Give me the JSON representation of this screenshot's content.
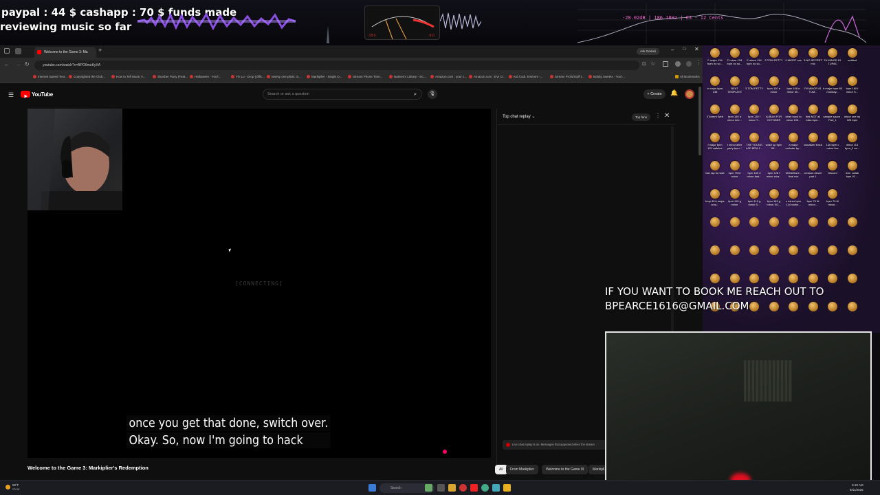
{
  "overlay": {
    "line1": "paypal : 44 $  cashapp : 70 $ funds made",
    "line2": "reviewing music so far",
    "spectrum_label": "-28.02dB | 186.18Hz | E3 - 12 Cents",
    "meter_left": "-18.0",
    "meter_right": "-9.0"
  },
  "browser": {
    "tabs": [
      {
        "label": "Welcome to the Game 3: Ma",
        "active": true
      }
    ],
    "new_tab": "+",
    "ask_label": "Ask Gemini",
    "url": "youtube.com/watch?v=BPO6muKyXA",
    "bookmarks": [
      "Internet Speed Test...",
      "Copyrighted the Club...",
      "How to Tell Music V...",
      "Slumber Party (Feat...",
      "Halloween - YouT...",
      "Yin Lu - Drop (Offic...",
      "twenty one pilots: S...",
      "Markiplier - Single O...",
      "Stream Phone Time...",
      "Natives's Library - SC...",
      "Amazon.com : your c...",
      "Amazon.com : EVI O...",
      "Kid Cudi, Eminem -...",
      "Stream Profs/Stuff t...",
      "Bobby Sweets - You'r..."
    ],
    "all_bookmarks": "All Bookmarks"
  },
  "youtube": {
    "logo": "YouTube",
    "search_placeholder": "Search or ask a question",
    "create": "+ Create",
    "connecting": "[CONNECTING]",
    "captions": [
      "once you get that done, switch over.",
      "Okay. So, now I'm going to hack"
    ],
    "video_title": "Welcome to the Game 3: Markiplier's Redemption",
    "chat": {
      "title": "Top chat replay ⌄",
      "top_fans": "Top fans",
      "note": "Live chat replay is on. Messages that appeared when the stream"
    },
    "chips": [
      {
        "label": "All",
        "active": true
      },
      {
        "label": "From Markiplier",
        "active": false
      },
      {
        "label": "Welcome to the Game III",
        "active": false
      },
      {
        "label": "Markipli",
        "active": false
      }
    ]
  },
  "desktop_icons": [
    "F major 134 bpm no so...",
    "F minor 134 bpm no so...",
    "F minor 134 bpm no so...",
    "3.TOM PETTY",
    "2.MIGRT mix",
    "3.NO SECRET mix",
    "F# MINOR 81 TUPAC",
    "untitled",
    "e major bpm 138",
    "BEAT TEMPLATE",
    "3.TOM PETTY",
    "bpm 130 e minor",
    "bpm 108 e minor tril...",
    "F# MINOR 81 TUM...",
    "b major bpm 85 monday...",
    "bpm 160 f minor S...",
    "3Torrent Web",
    "bpm 150 d minor inte...",
    "bpm 130 f minor T...",
    "ALBUM FOR OCTOBER",
    "other track to minor 105...",
    "that NOT all folks bpm...",
    "sample sauce - Part_1",
    "minor one try 126 bpm",
    "f major bpm 115 caffeine",
    "f minor after party bpm...",
    "THE YOUNG LAD BPM 1...",
    "wake up bpm 86...",
    "a major rockstar bp...",
    "visualizer track",
    "136 bpm c minor live",
    "minor 114 bpm_2 ca...",
    "fast rap for sale",
    "bpm 75 f# minor",
    "bpm 160 d minor fast...",
    "bpm 128 f minor wha...",
    "MONOtone - final mix",
    "crimson desert part 1",
    "Discord",
    "river collab bpm 92 ...",
    "bmp 96 b major sma...",
    "bpm 110 g minor",
    "bpm 110 g minor S...",
    "bpm 163 g minor SO...",
    "c minor bpm 144 victim...",
    "bpm 70 f# minor...",
    "bpm 70 f# minor..."
  ],
  "book_text": {
    "line1": "IF YOU WANT TO BOOK ME REACH OUT TO",
    "line2": "BPEARCE1616@GMAIL.COM"
  },
  "taskbar": {
    "weather_temp": "59°F",
    "weather_desc": "Clear",
    "search": "Search",
    "time": "9:19 AM",
    "date": "8/11/2026"
  },
  "colors": {
    "youtube_red": "#ff0000",
    "overlay_wave": "#8a4ee0"
  }
}
